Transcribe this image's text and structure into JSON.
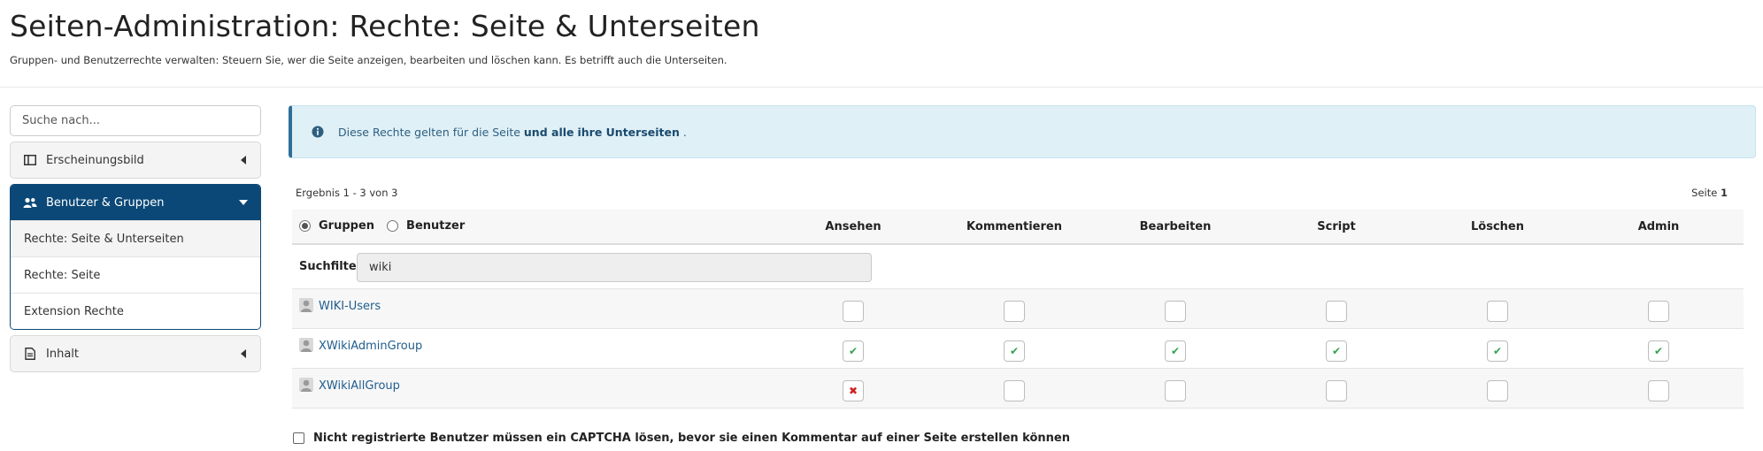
{
  "header": {
    "title": "Seiten-Administration: Rechte: Seite & Unterseiten",
    "subtitle": "Gruppen- und Benutzerrechte verwalten: Steuern Sie, wer die Seite anzeigen, bearbeiten und löschen kann. Es betrifft auch die Unterseiten."
  },
  "sidebar": {
    "search_placeholder": "Suche nach...",
    "panels": [
      {
        "label": "Erscheinungsbild",
        "icon": "layout-columns-icon",
        "caret": "caret-left-icon"
      },
      {
        "label": "Benutzer & Gruppen",
        "icon": "users-icon",
        "caret": "caret-down-icon",
        "items": [
          {
            "label": "Rechte: Seite & Unterseiten"
          },
          {
            "label": "Rechte: Seite"
          },
          {
            "label": "Extension Rechte"
          }
        ]
      },
      {
        "label": "Inhalt",
        "icon": "document-icon",
        "caret": "caret-left-icon"
      }
    ]
  },
  "alert": {
    "text_1": "Diese Rechte gelten für die Seite",
    "text_2": "und alle",
    "text_3": "ihre Unterseiten",
    "text_4": "."
  },
  "results": {
    "summary": "Ergebnis 1 - 3 von 3",
    "page_label": "Seite",
    "page_number": "1"
  },
  "table": {
    "radio_groups": "Gruppen",
    "radio_users": "Benutzer",
    "columns": [
      "Ansehen",
      "Kommentieren",
      "Bearbeiten",
      "Script",
      "Löschen",
      "Admin"
    ],
    "filter_label": "Suchfilter:",
    "filter_value": "wiki",
    "rows": [
      {
        "name": "WIKI-Users",
        "rights": [
          "none",
          "none",
          "none",
          "none",
          "none",
          "none"
        ]
      },
      {
        "name": "XWikiAdminGroup",
        "rights": [
          "allow",
          "allow",
          "allow",
          "allow",
          "allow",
          "allow"
        ]
      },
      {
        "name": "XWikiAllGroup",
        "rights": [
          "deny",
          "none",
          "none",
          "none",
          "none",
          "none"
        ]
      }
    ]
  },
  "captcha": {
    "label": "Nicht registrierte Benutzer müssen ein CAPTCHA lösen, bevor sie einen Kommentar auf einer Seite erstellen können"
  },
  "colors": {
    "accent": "#0b4877",
    "link": "#1f5d8c",
    "alert_bg": "#dff0f7",
    "allow": "#2fa34f",
    "deny": "#cc2222"
  }
}
